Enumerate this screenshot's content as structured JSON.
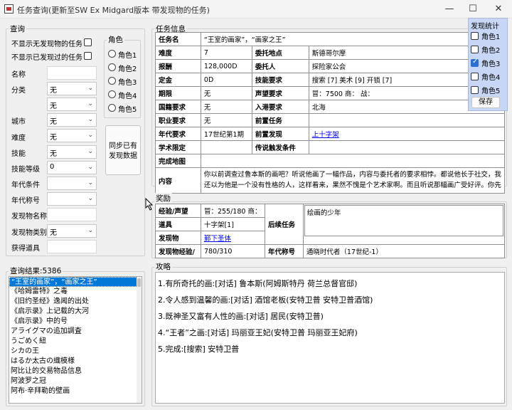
{
  "window": {
    "title": "任务查询(更新至SW Ex Midgard版本 带发现物的任务)",
    "min_glyph": "—",
    "max_glyph": "☐",
    "close_glyph": "✕"
  },
  "query": {
    "title": "查询",
    "hide_no_discovery": "不显示无发现物的任务",
    "hide_discovered": "不显示已发现过的任务",
    "labels": {
      "name": "名称",
      "category": "分类",
      "city": "城市",
      "difficulty": "难度",
      "skill": "技能",
      "skill_level": "技能等级",
      "era": "年代条件",
      "era_title": "年代称号",
      "discovery_name": "发现物名称",
      "discovery_type": "发现物类别",
      "reward_item": "获得道具"
    },
    "values": {
      "category1": "无",
      "category2": "无",
      "city": "无",
      "difficulty": "无",
      "skill": "无",
      "skill_level": "0",
      "discovery_type": "无"
    },
    "role_title": "角色",
    "roles": [
      "角色1",
      "角色2",
      "角色3",
      "角色4",
      "角色5"
    ],
    "sync_label": "同步已有发现数据"
  },
  "quest": {
    "title": "任务信息",
    "rows": [
      {
        "k1": "任务名",
        "v1": "“王室的画家”，“画家之王”"
      },
      {
        "k1": "难度",
        "v1": "7",
        "k2": "委托地点",
        "v2": "斯德哥尔摩"
      },
      {
        "k1": "报酬",
        "v1": "128,000D",
        "k2": "委托人",
        "v2": "探险家公会"
      },
      {
        "k1": "定金",
        "v1": "0D",
        "k2": "技能要求",
        "v2": "搜索 [7] 美术 [9] 开锁 [7]"
      },
      {
        "k1": "期限",
        "v1": "无",
        "k2": "声望要求",
        "v2": "冒：7500 商：  战："
      },
      {
        "k1": "国籍要求",
        "v1": "无",
        "k2": "入港要求",
        "v2": "北海"
      },
      {
        "k1": "职业要求",
        "v1": "无",
        "k2": "前置任务",
        "v2": ""
      },
      {
        "k1": "年代要求",
        "v1": "17世纪第1期",
        "k2": "前置发现",
        "v2": "上十字架"
      },
      {
        "k1": "学术限定",
        "v1": "",
        "k2": "传说触发条件",
        "v2": ""
      },
      {
        "k1": "完成地图",
        "v1": ""
      }
    ],
    "content_label": "内容",
    "content_text": "你以前调查过鲁本斯的画吧？听说他画了一幅作品，内容与委托者的要求相悖。都说他长于社交，我还以为他是一个没有性格的人，这样看来，果然不愧是个艺术家啊。而且听说那幅画广受好评。你先"
  },
  "reward": {
    "title": "奖励",
    "exp_label": "经验/声望",
    "exp_value": "冒：255/180 商：",
    "item_label": "道具",
    "item_value": "十字架[1]",
    "disc_label": "发现物",
    "disc_value": "鄞下圣体",
    "disc_exp_label": "发现物经验/",
    "disc_exp_value": "780/310",
    "followup_label": "后续任务",
    "followup_value": "绘画的少年",
    "era_title_label": "年代称号",
    "era_title_value": "通晓时代者（17世纪-1）"
  },
  "results": {
    "title": "查询结果:5386",
    "items": [
      "“王室的画家”，“画家之王”",
      "《哈姆雷特》之毒",
      "《旧约圣经》逸闻的出处",
      "《启示录》上记载的大河",
      "《启示录》中的号",
      "アライグマの追加調査",
      "うごめく紐",
      "シカの王",
      "はるか太古の織模様",
      "阿比让的交易物品信息",
      "阿波罗之冠",
      "阿布·辛拜勒的壁画"
    ]
  },
  "guide": {
    "title": "攻略",
    "lines": [
      "1.有所奇托的画:[对话] 鲁本斯(阿姆斯特丹 荷兰总督官邸)",
      "2.令人感到温馨的画:[对话] 酒馆老板(安特卫普 安特卫普酒馆)",
      "3.既神圣又富有人性的画:[对话] 居民(安特卫普)",
      "4.“王者”之画:[对话] 玛丽亚王妃(安特卫普 玛丽亚王妃府)",
      "5.完成:[搜索] 安特卫普"
    ]
  },
  "stats": {
    "title": "发现统计",
    "roles": [
      "角色1",
      "角色2",
      "角色3",
      "角色4",
      "角色5"
    ],
    "checked_index": 2,
    "save_label": "保存"
  },
  "colors": {
    "selection": "#0078d7",
    "stats_panel": "#c8d7f5",
    "link": "#0000ee"
  }
}
